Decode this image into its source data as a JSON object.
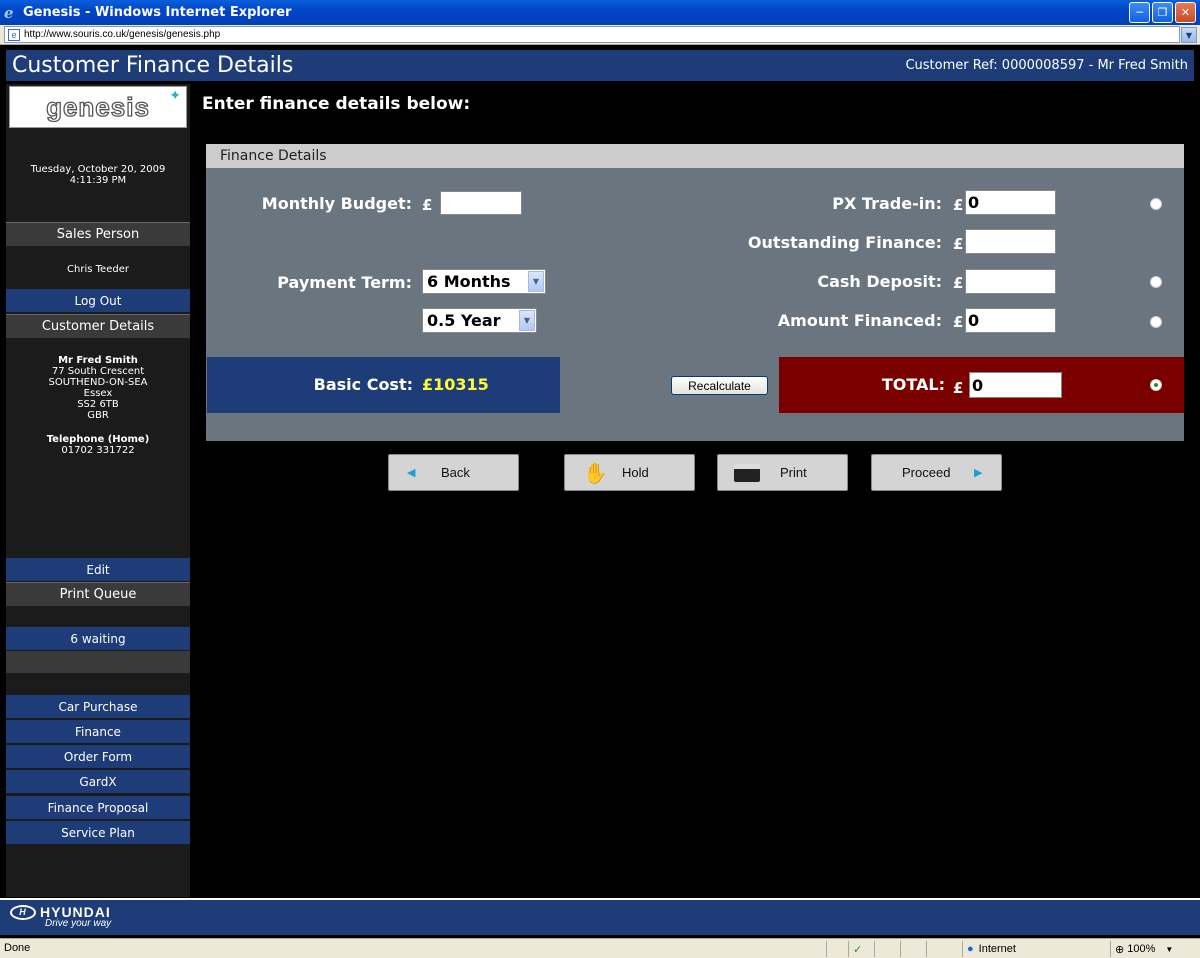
{
  "window": {
    "title": "Genesis - Windows Internet Explorer",
    "url": "http://www.souris.co.uk/genesis/genesis.php"
  },
  "header": {
    "title": "Customer Finance Details",
    "customer_ref": "Customer Ref: 0000008597 - Mr Fred Smith"
  },
  "sidebar": {
    "logo_text": "genesis",
    "date": "Tuesday, October 20, 2009",
    "time": "4:11:39 PM",
    "sales_person_heading": "Sales Person",
    "sales_person_name": "Chris Teeder",
    "logout_label": "Log Out",
    "customer_details_heading": "Customer Details",
    "customer": {
      "name": "Mr Fred Smith",
      "address": [
        "77 South Crescent",
        "SOUTHEND-ON-SEA",
        "Essex",
        "SS2 6TB",
        "GBR"
      ],
      "phone_label": "Telephone (Home)",
      "phone": "01702 331722"
    },
    "edit_label": "Edit",
    "print_queue_heading": "Print Queue",
    "print_queue_status": "6 waiting",
    "menu": [
      {
        "label": "Car Purchase"
      },
      {
        "label": "Finance"
      },
      {
        "label": "Order Form"
      },
      {
        "label": "GardX"
      },
      {
        "label": "Finance Proposal"
      },
      {
        "label": "Service Plan"
      }
    ]
  },
  "main": {
    "heading": "Enter finance details below:",
    "panel_title": "Finance Details",
    "currency_symbol": "£",
    "monthly_budget": {
      "label": "Monthly Budget:",
      "value": ""
    },
    "payment_term": {
      "label": "Payment Term:",
      "months_value": "6 Months",
      "years_value": "0.5 Year"
    },
    "px_trade_in": {
      "label": "PX Trade-in:",
      "value": "0"
    },
    "outstanding_finance": {
      "label": "Outstanding Finance:",
      "value": ""
    },
    "cash_deposit": {
      "label": "Cash Deposit:",
      "value": ""
    },
    "amount_financed": {
      "label": "Amount Financed:",
      "value": "0"
    },
    "basic_cost": {
      "label": "Basic Cost:",
      "value": "£10315"
    },
    "recalculate_label": "Recalculate",
    "total": {
      "label": "TOTAL:",
      "value": "0"
    }
  },
  "actions": {
    "back_label": "Back",
    "hold_label": "Hold",
    "print_label": "Print",
    "proceed_label": "Proceed"
  },
  "brand": {
    "logo_text": "HYUNDAI",
    "tagline": "Drive your way"
  },
  "statusbar": {
    "status": "Done",
    "zone": "Internet",
    "zoom": "100%"
  },
  "colors": {
    "header_blue": "#1d3c78",
    "total_red": "#7a0000",
    "basic_cost_yellow": "#ffff33",
    "panel_gray": "#6b7580"
  }
}
